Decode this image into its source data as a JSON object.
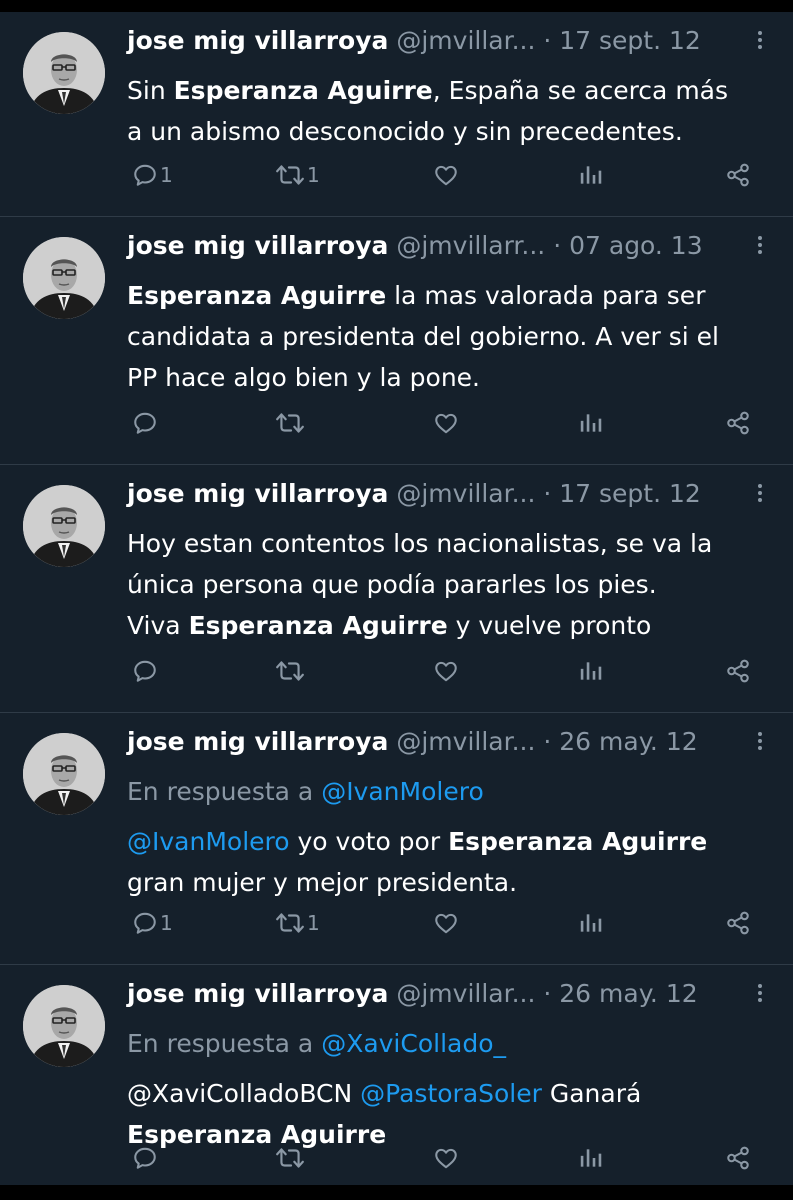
{
  "tweets": [
    {
      "name": "jose mig villarroya",
      "handle": "@jmvillar...",
      "date": "17 sept. 12",
      "reply_prefix": "",
      "reply_mention": "",
      "lines": [
        [
          {
            "t": "Sin ",
            "s": "n"
          },
          {
            "t": "Esperanza Aguirre",
            "s": "b"
          },
          {
            "t": ", España se acerca más",
            "s": "n"
          }
        ],
        [
          {
            "t": "a un abismo desconocido y sin precedentes.",
            "s": "n"
          }
        ]
      ],
      "replies": "1",
      "retweets": "1"
    },
    {
      "name": "jose mig villarroya",
      "handle": "@jmvillarr...",
      "date": "07 ago. 13",
      "reply_prefix": "",
      "reply_mention": "",
      "lines": [
        [
          {
            "t": "Esperanza Aguirre",
            "s": "b"
          },
          {
            "t": " la mas valorada para ser",
            "s": "n"
          }
        ],
        [
          {
            "t": "candidata a presidenta del gobierno. A ver si el",
            "s": "n"
          }
        ],
        [
          {
            "t": "PP hace algo bien y la pone.",
            "s": "n"
          }
        ]
      ],
      "replies": "",
      "retweets": ""
    },
    {
      "name": "jose mig villarroya",
      "handle": "@jmvillar...",
      "date": "17 sept. 12",
      "reply_prefix": "",
      "reply_mention": "",
      "lines": [
        [
          {
            "t": "Hoy estan contentos los nacionalistas, se va la",
            "s": "n"
          }
        ],
        [
          {
            "t": "única persona que podía pararles los pies.",
            "s": "n"
          }
        ],
        [
          {
            "t": "Viva ",
            "s": "n"
          },
          {
            "t": "Esperanza Aguirre",
            "s": "b"
          },
          {
            "t": " y vuelve pronto",
            "s": "n"
          }
        ]
      ],
      "replies": "",
      "retweets": ""
    },
    {
      "name": "jose mig villarroya",
      "handle": "@jmvillar...",
      "date": "26 may. 12",
      "reply_prefix": "En respuesta a ",
      "reply_mention": "@IvanMolero",
      "lines": [
        [
          {
            "t": "@IvanMolero",
            "s": "m"
          },
          {
            "t": " yo voto por ",
            "s": "n"
          },
          {
            "t": "Esperanza Aguirre",
            "s": "b"
          }
        ],
        [
          {
            "t": "gran mujer y mejor presidenta.",
            "s": "n"
          }
        ]
      ],
      "replies": "1",
      "retweets": "1"
    },
    {
      "name": "jose mig villarroya",
      "handle": "@jmvillar...",
      "date": "26 may. 12",
      "reply_prefix": "En respuesta a ",
      "reply_mention": "@XaviCollado_",
      "lines": [
        [
          {
            "t": "@XaviColladoBCN ",
            "s": "n"
          },
          {
            "t": "@PastoraSoler",
            "s": "m"
          },
          {
            "t": " Ganará",
            "s": "n"
          }
        ],
        [
          {
            "t": "Esperanza Aguirre",
            "s": "b"
          }
        ]
      ],
      "replies": "",
      "retweets": ""
    }
  ],
  "colors": {
    "background": "#15202b",
    "text": "#ffffff",
    "secondary": "#8b98a5",
    "link": "#1d9bf0",
    "divider": "#2f3b47"
  },
  "icons": {
    "reply": "reply-icon",
    "retweet": "retweet-icon",
    "like": "like-icon",
    "views": "views-icon",
    "share": "share-icon",
    "more": "more-icon"
  }
}
